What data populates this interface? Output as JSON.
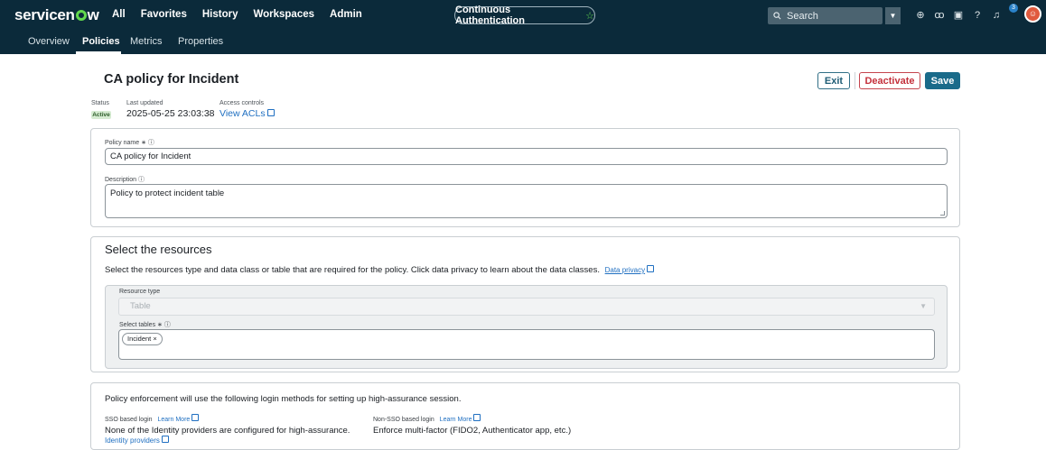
{
  "nav": {
    "logo": "servicenow",
    "items": [
      "All",
      "Favorites",
      "History",
      "Workspaces",
      "Admin"
    ],
    "context_pill": "Continuous Authentication",
    "search_placeholder": "Search",
    "notification_count": "3"
  },
  "subnav": {
    "tabs": [
      "Overview",
      "Policies",
      "Metrics",
      "Properties"
    ],
    "active": "Policies"
  },
  "header": {
    "title": "CA policy for Incident",
    "exit_label": "Exit",
    "deactivate_label": "Deactivate",
    "save_label": "Save",
    "status_label": "Status",
    "status_value": "Active",
    "updated_label": "Last updated",
    "updated_value": "2025-05-25 23:03:38",
    "acl_label": "Access controls",
    "acl_link": "View ACLs"
  },
  "policy": {
    "name_label": "Policy name ∗ ⓘ",
    "name_value": "CA policy for Incident",
    "desc_label": "Description ⓘ",
    "desc_value": "Policy to protect incident table"
  },
  "resources": {
    "title": "Select the resources",
    "description": "Select the resources type and data class or table that are required for the policy. Click data privacy to learn about the data classes.",
    "privacy_link": "Data privacy",
    "resource_type_label": "Resource type",
    "resource_type_value": "Table",
    "tables_label": "Select tables ∗ ⓘ",
    "tags": [
      "Incident"
    ]
  },
  "login": {
    "heading": "Policy enforcement will use the following login methods for setting up high-assurance session.",
    "sso_label": "SSO based login",
    "sso_link": "Learn More",
    "sso_value": "None of the Identity providers are configured for high-assurance.",
    "idp_link": "Identity providers",
    "nonsso_label": "Non-SSO based login",
    "nonsso_link": "Learn More",
    "nonsso_value": "Enforce multi-factor (FIDO2, Authenticator app, etc.)"
  },
  "colors": {
    "nav_bg": "#0b2a3a",
    "brand_green": "#62d84e",
    "primary": "#1a6b8a",
    "danger": "#c4303b",
    "link": "#1f6fc1"
  }
}
